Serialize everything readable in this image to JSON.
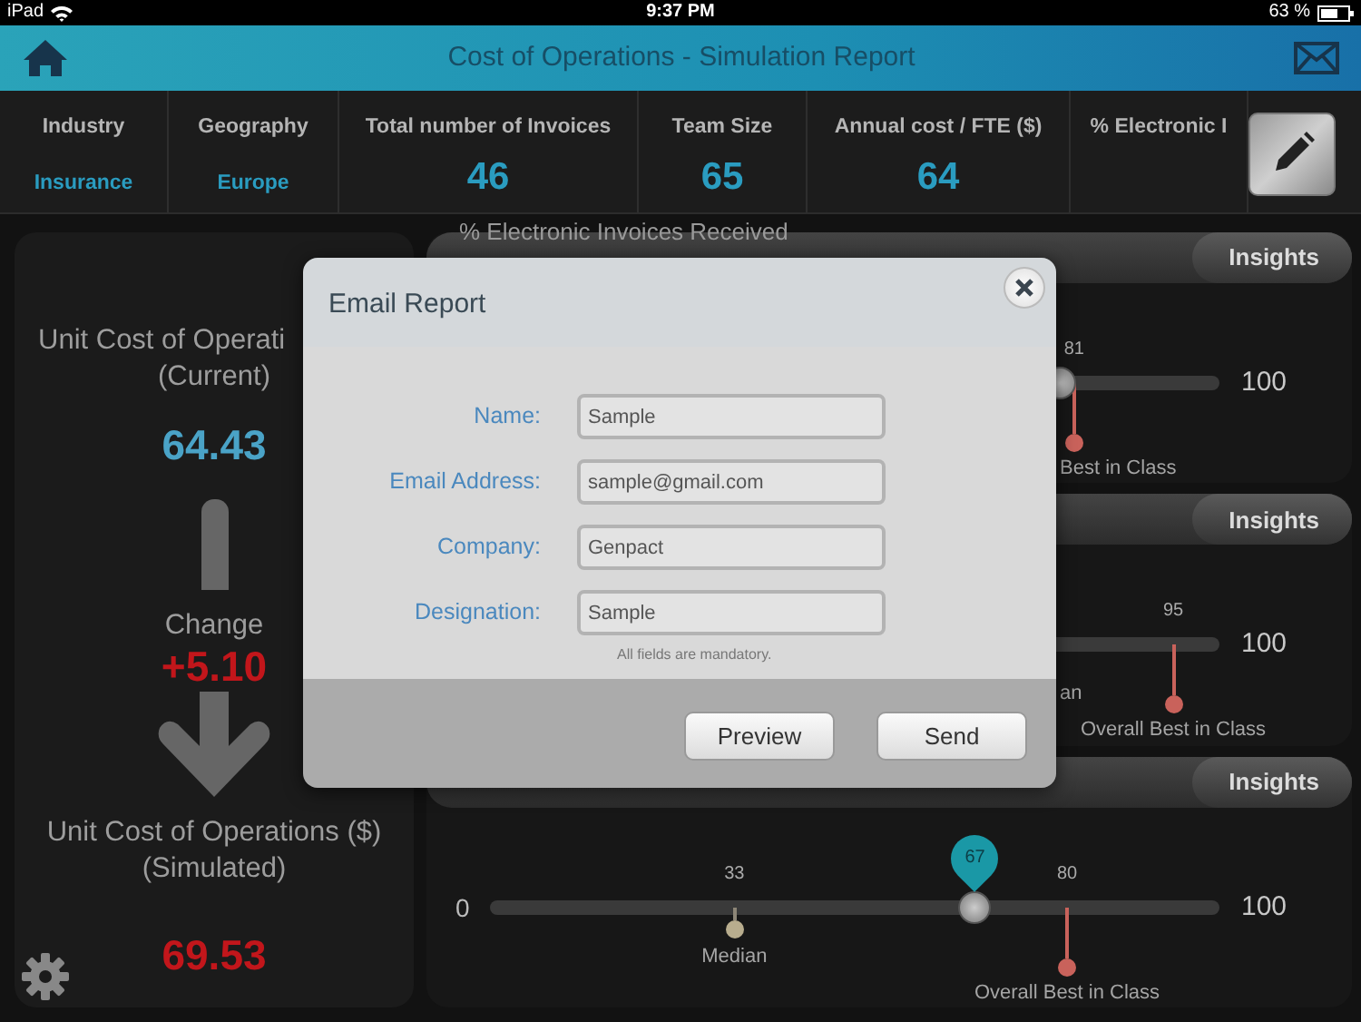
{
  "status_bar": {
    "device": "iPad",
    "time": "9:37 PM",
    "battery": "63 %"
  },
  "header": {
    "title": "Cost of Operations - Simulation Report"
  },
  "metrics": [
    {
      "label": "Industry",
      "value": "Insurance",
      "kind": "text"
    },
    {
      "label": "Geography",
      "value": "Europe",
      "kind": "text"
    },
    {
      "label": "Total number of Invoices",
      "value": "46",
      "kind": "number"
    },
    {
      "label": "Team Size",
      "value": "65",
      "kind": "number"
    },
    {
      "label": "Annual cost / FTE ($)",
      "value": "64",
      "kind": "number"
    },
    {
      "label": "% Electronic I"
    }
  ],
  "summary": {
    "current_label": "Unit Cost of Operati",
    "current_sublabel": "(Current)",
    "current_value": "64.43",
    "change_label": "Change",
    "change_value": "+5.10",
    "simulated_label": "Unit Cost of Operations ($)",
    "simulated_sublabel": "(Simulated)",
    "simulated_value": "69.53"
  },
  "panels": [
    {
      "title": "% Electronic Invoices Received",
      "insights": "Insights",
      "scale_max": "100",
      "slider": {
        "level": 0.79
      },
      "markers": [
        {
          "kind": "best",
          "value": "81",
          "label": "Best in Class",
          "level": 0.81
        }
      ]
    },
    {
      "insights": "Insights",
      "scale_max": "100",
      "markers": [
        {
          "kind": "median",
          "label": "an"
        },
        {
          "kind": "best",
          "value": "95",
          "label": "Overall Best in Class",
          "level": 0.95
        }
      ]
    },
    {
      "insights": "Insights",
      "scale_min": "0",
      "scale_max": "100",
      "slider": {
        "level": 0.67,
        "bubble": "67"
      },
      "markers": [
        {
          "kind": "median",
          "value": "33",
          "label": "Median",
          "level": 0.33
        },
        {
          "kind": "best",
          "value": "80",
          "label": "Overall Best in Class",
          "level": 0.8
        }
      ]
    }
  ],
  "dialog": {
    "title": "Email Report",
    "fields": [
      {
        "label": "Name:",
        "value": "Sample"
      },
      {
        "label": "Email Address:",
        "value": "sample@gmail.com"
      },
      {
        "label": "Company:",
        "value": "Genpact"
      },
      {
        "label": "Designation:",
        "value": "Sample"
      }
    ],
    "note": "All fields are mandatory.",
    "buttons": [
      "Preview",
      "Send"
    ]
  }
}
